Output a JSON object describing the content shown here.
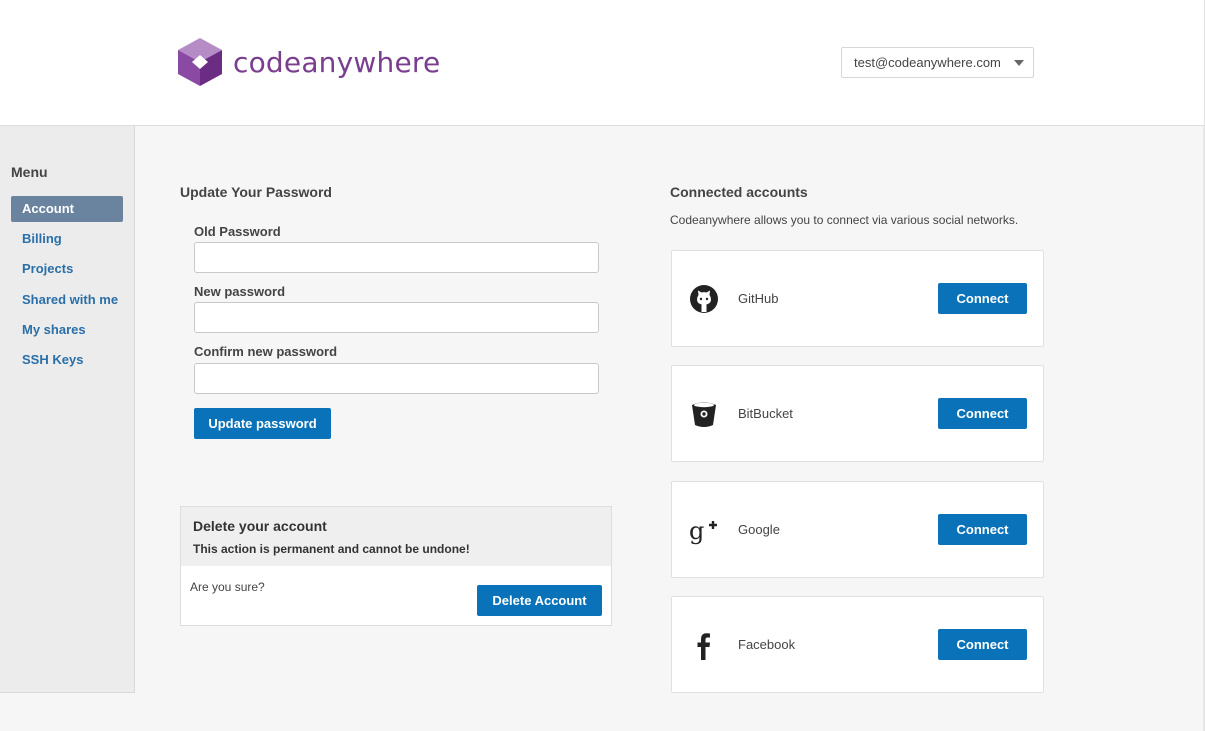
{
  "header": {
    "brand": "codeanywhere",
    "user_email": "test@codeanywhere.com",
    "accent_color": "#7a3e8f"
  },
  "sidebar": {
    "title": "Menu",
    "items": [
      {
        "label": "Account",
        "active": true
      },
      {
        "label": "Billing"
      },
      {
        "label": "Projects"
      },
      {
        "label": "Shared with me"
      },
      {
        "label": "My shares"
      },
      {
        "label": "SSH Keys"
      }
    ]
  },
  "password": {
    "title": "Update Your Password",
    "old_label": "Old Password",
    "new_label": "New password",
    "confirm_label": "Confirm new password",
    "old_value": "",
    "new_value": "",
    "confirm_value": "",
    "button": "Update password"
  },
  "delete": {
    "title": "Delete your account",
    "description": "This action is permanent and cannot be undone!",
    "question": "Are you sure?",
    "button": "Delete Account"
  },
  "connected": {
    "title": "Connected accounts",
    "description": "Codeanywhere allows you to connect via various social networks.",
    "accounts": [
      {
        "name": "GitHub",
        "icon": "github-icon",
        "button": "Connect"
      },
      {
        "name": "BitBucket",
        "icon": "bitbucket-icon",
        "button": "Connect"
      },
      {
        "name": "Google",
        "icon": "google-plus-icon",
        "button": "Connect"
      },
      {
        "name": "Facebook",
        "icon": "facebook-icon",
        "button": "Connect"
      }
    ]
  },
  "colors": {
    "primary_button": "#0a72b8",
    "active_menu": "#6a84a0",
    "link": "#2a6fa8"
  }
}
